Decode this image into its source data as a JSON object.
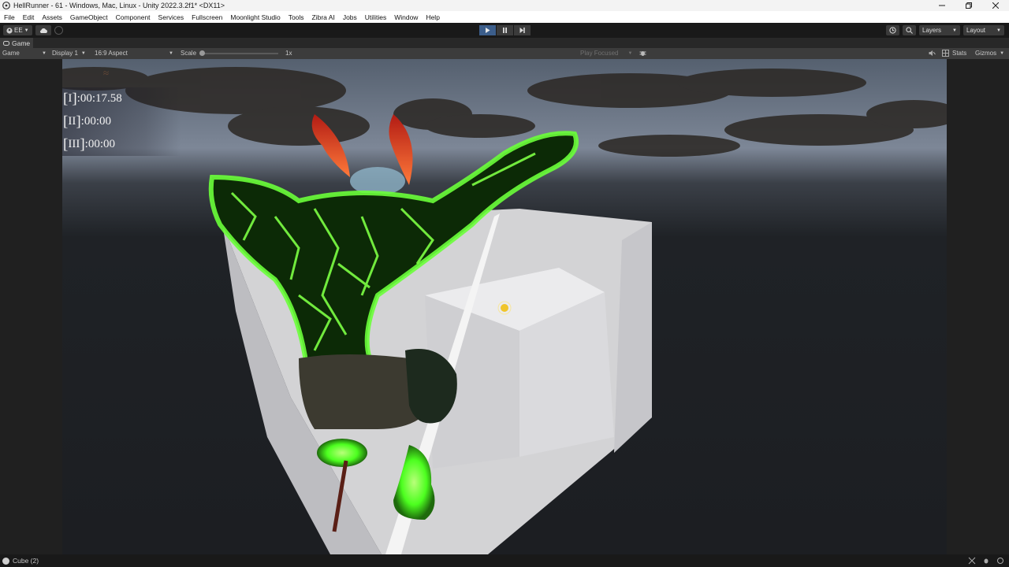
{
  "window": {
    "title": "HellRunner - 61 - Windows, Mac, Linux - Unity 2022.3.2f1* <DX11>",
    "controls": [
      "minimize",
      "restore",
      "close"
    ]
  },
  "menu": [
    "File",
    "Edit",
    "Assets",
    "GameObject",
    "Component",
    "Services",
    "Fullscreen",
    "Moonlight Studio",
    "Tools",
    "Zibra AI",
    "Jobs",
    "Utilities",
    "Window",
    "Help"
  ],
  "toolbar": {
    "account_label": "EE",
    "layers_label": "Layers",
    "layout_label": "Layout",
    "play_state": "playing"
  },
  "game_tab": {
    "tab_label": "Game",
    "view_mode": "Game",
    "display": "Display 1",
    "aspect": "16:9 Aspect",
    "scale_label": "Scale",
    "scale_value": "1x",
    "play_focused": "Play Focused",
    "stats_label": "Stats",
    "gizmos_label": "Gizmos"
  },
  "hud": {
    "timers": [
      {
        "index": "I",
        "time": ":00:17.58"
      },
      {
        "index": "II",
        "time": ":00:00"
      },
      {
        "index": "III",
        "time": ":00:00"
      }
    ]
  },
  "status": {
    "selection": "Cube (2)"
  },
  "colors": {
    "play_active": "#3c5e8b",
    "glow_green": "#6aff3a",
    "flame_red": "#e0452a"
  }
}
